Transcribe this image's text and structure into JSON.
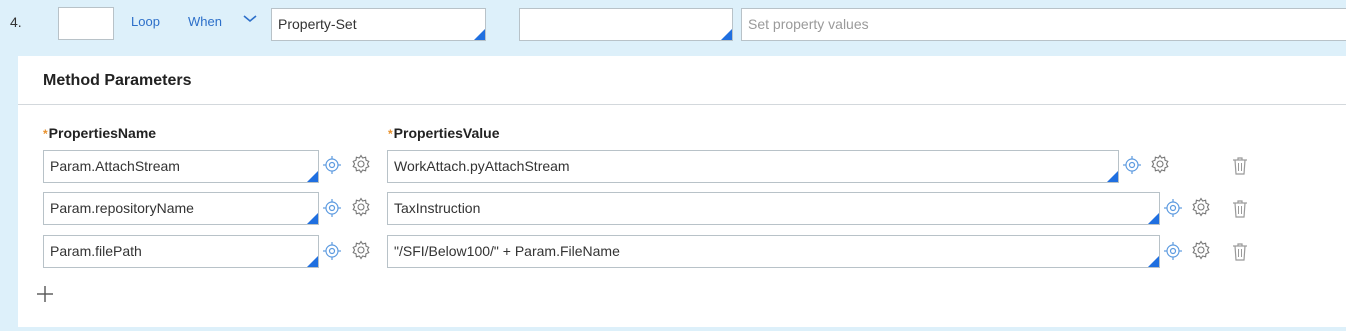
{
  "step": {
    "number": "4.",
    "loop_label": "Loop",
    "when_label": "When",
    "method_value": "Property-Set",
    "step_page_value": "",
    "description_placeholder": "Set property values"
  },
  "panel": {
    "title": "Method Parameters",
    "columns": {
      "name_header": "PropertiesName",
      "value_header": "PropertiesValue",
      "required_marker": "*"
    },
    "rows": [
      {
        "name": "Param.AttachStream",
        "value": "WorkAttach.pyAttachStream"
      },
      {
        "name": "Param.repositoryName",
        "value": "TaxInstruction"
      },
      {
        "name": "Param.filePath",
        "value": "\"/SFI/Below100/\" + Param.FileName"
      }
    ]
  },
  "colors": {
    "accent_blue": "#1f6fe0",
    "link_blue": "#2c6fc9",
    "row_background": "#ddf0fa",
    "required_orange": "#e8912d"
  },
  "icons": [
    "chevron-down-icon",
    "target-icon",
    "gear-icon",
    "trash-icon",
    "plus-icon"
  ]
}
